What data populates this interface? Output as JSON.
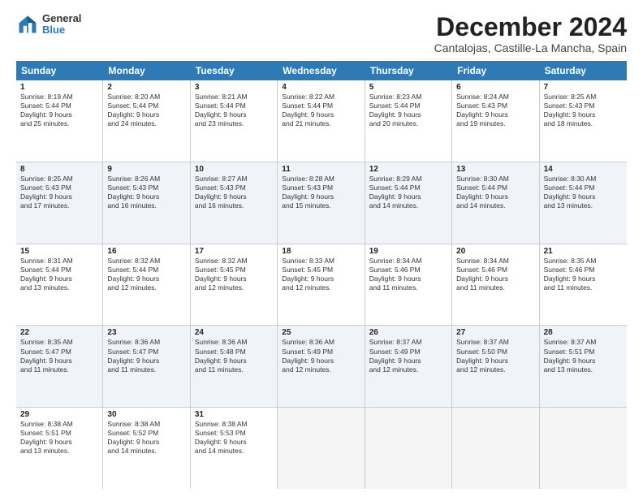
{
  "logo": {
    "line1": "General",
    "line2": "Blue"
  },
  "title": "December 2024",
  "subtitle": "Cantalojas, Castille-La Mancha, Spain",
  "header_days": [
    "Sunday",
    "Monday",
    "Tuesday",
    "Wednesday",
    "Thursday",
    "Friday",
    "Saturday"
  ],
  "weeks": [
    [
      {
        "day": "1",
        "lines": [
          "Sunrise: 8:19 AM",
          "Sunset: 5:44 PM",
          "Daylight: 9 hours",
          "and 25 minutes."
        ]
      },
      {
        "day": "2",
        "lines": [
          "Sunrise: 8:20 AM",
          "Sunset: 5:44 PM",
          "Daylight: 9 hours",
          "and 24 minutes."
        ]
      },
      {
        "day": "3",
        "lines": [
          "Sunrise: 8:21 AM",
          "Sunset: 5:44 PM",
          "Daylight: 9 hours",
          "and 23 minutes."
        ]
      },
      {
        "day": "4",
        "lines": [
          "Sunrise: 8:22 AM",
          "Sunset: 5:44 PM",
          "Daylight: 9 hours",
          "and 21 minutes."
        ]
      },
      {
        "day": "5",
        "lines": [
          "Sunrise: 8:23 AM",
          "Sunset: 5:44 PM",
          "Daylight: 9 hours",
          "and 20 minutes."
        ]
      },
      {
        "day": "6",
        "lines": [
          "Sunrise: 8:24 AM",
          "Sunset: 5:43 PM",
          "Daylight: 9 hours",
          "and 19 minutes."
        ]
      },
      {
        "day": "7",
        "lines": [
          "Sunrise: 8:25 AM",
          "Sunset: 5:43 PM",
          "Daylight: 9 hours",
          "and 18 minutes."
        ]
      }
    ],
    [
      {
        "day": "8",
        "lines": [
          "Sunrise: 8:25 AM",
          "Sunset: 5:43 PM",
          "Daylight: 9 hours",
          "and 17 minutes."
        ]
      },
      {
        "day": "9",
        "lines": [
          "Sunrise: 8:26 AM",
          "Sunset: 5:43 PM",
          "Daylight: 9 hours",
          "and 16 minutes."
        ]
      },
      {
        "day": "10",
        "lines": [
          "Sunrise: 8:27 AM",
          "Sunset: 5:43 PM",
          "Daylight: 9 hours",
          "and 16 minutes."
        ]
      },
      {
        "day": "11",
        "lines": [
          "Sunrise: 8:28 AM",
          "Sunset: 5:43 PM",
          "Daylight: 9 hours",
          "and 15 minutes."
        ]
      },
      {
        "day": "12",
        "lines": [
          "Sunrise: 8:29 AM",
          "Sunset: 5:44 PM",
          "Daylight: 9 hours",
          "and 14 minutes."
        ]
      },
      {
        "day": "13",
        "lines": [
          "Sunrise: 8:30 AM",
          "Sunset: 5:44 PM",
          "Daylight: 9 hours",
          "and 14 minutes."
        ]
      },
      {
        "day": "14",
        "lines": [
          "Sunrise: 8:30 AM",
          "Sunset: 5:44 PM",
          "Daylight: 9 hours",
          "and 13 minutes."
        ]
      }
    ],
    [
      {
        "day": "15",
        "lines": [
          "Sunrise: 8:31 AM",
          "Sunset: 5:44 PM",
          "Daylight: 9 hours",
          "and 13 minutes."
        ]
      },
      {
        "day": "16",
        "lines": [
          "Sunrise: 8:32 AM",
          "Sunset: 5:44 PM",
          "Daylight: 9 hours",
          "and 12 minutes."
        ]
      },
      {
        "day": "17",
        "lines": [
          "Sunrise: 8:32 AM",
          "Sunset: 5:45 PM",
          "Daylight: 9 hours",
          "and 12 minutes."
        ]
      },
      {
        "day": "18",
        "lines": [
          "Sunrise: 8:33 AM",
          "Sunset: 5:45 PM",
          "Daylight: 9 hours",
          "and 12 minutes."
        ]
      },
      {
        "day": "19",
        "lines": [
          "Sunrise: 8:34 AM",
          "Sunset: 5:46 PM",
          "Daylight: 9 hours",
          "and 11 minutes."
        ]
      },
      {
        "day": "20",
        "lines": [
          "Sunrise: 8:34 AM",
          "Sunset: 5:46 PM",
          "Daylight: 9 hours",
          "and 11 minutes."
        ]
      },
      {
        "day": "21",
        "lines": [
          "Sunrise: 8:35 AM",
          "Sunset: 5:46 PM",
          "Daylight: 9 hours",
          "and 11 minutes."
        ]
      }
    ],
    [
      {
        "day": "22",
        "lines": [
          "Sunrise: 8:35 AM",
          "Sunset: 5:47 PM",
          "Daylight: 9 hours",
          "and 11 minutes."
        ]
      },
      {
        "day": "23",
        "lines": [
          "Sunrise: 8:36 AM",
          "Sunset: 5:47 PM",
          "Daylight: 9 hours",
          "and 11 minutes."
        ]
      },
      {
        "day": "24",
        "lines": [
          "Sunrise: 8:36 AM",
          "Sunset: 5:48 PM",
          "Daylight: 9 hours",
          "and 11 minutes."
        ]
      },
      {
        "day": "25",
        "lines": [
          "Sunrise: 8:36 AM",
          "Sunset: 5:49 PM",
          "Daylight: 9 hours",
          "and 12 minutes."
        ]
      },
      {
        "day": "26",
        "lines": [
          "Sunrise: 8:37 AM",
          "Sunset: 5:49 PM",
          "Daylight: 9 hours",
          "and 12 minutes."
        ]
      },
      {
        "day": "27",
        "lines": [
          "Sunrise: 8:37 AM",
          "Sunset: 5:50 PM",
          "Daylight: 9 hours",
          "and 12 minutes."
        ]
      },
      {
        "day": "28",
        "lines": [
          "Sunrise: 8:37 AM",
          "Sunset: 5:51 PM",
          "Daylight: 9 hours",
          "and 13 minutes."
        ]
      }
    ],
    [
      {
        "day": "29",
        "lines": [
          "Sunrise: 8:38 AM",
          "Sunset: 5:51 PM",
          "Daylight: 9 hours",
          "and 13 minutes."
        ]
      },
      {
        "day": "30",
        "lines": [
          "Sunrise: 8:38 AM",
          "Sunset: 5:52 PM",
          "Daylight: 9 hours",
          "and 14 minutes."
        ]
      },
      {
        "day": "31",
        "lines": [
          "Sunrise: 8:38 AM",
          "Sunset: 5:53 PM",
          "Daylight: 9 hours",
          "and 14 minutes."
        ]
      },
      null,
      null,
      null,
      null
    ]
  ]
}
